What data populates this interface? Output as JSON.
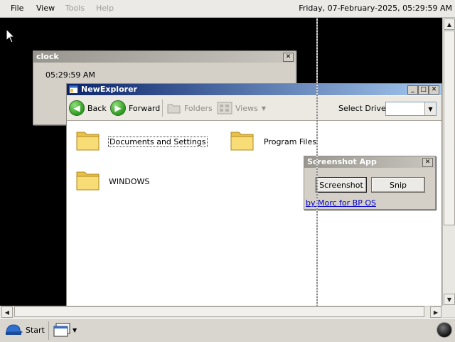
{
  "menubar": {
    "file": "File",
    "view": "View",
    "tools": "Tools",
    "help": "Help",
    "datetime": "Friday, 07-February-2025, 05:29:59 AM"
  },
  "clock_window": {
    "title": "clock",
    "time": "05:29:59 AM"
  },
  "explorer": {
    "title": "NewExplorer",
    "back": "Back",
    "forward": "Forward",
    "folders": "Folders",
    "views": "Views",
    "select_drive_label": "Select Drive:",
    "select_drive_value": "",
    "items": [
      {
        "name": "Documents and Settings"
      },
      {
        "name": "Program Files"
      },
      {
        "name": "WINDOWS"
      }
    ]
  },
  "screenshot_app": {
    "title": "Screenshot App",
    "screenshot_button": "Screenshot",
    "snip_button": "Snip",
    "credit_link": "by Morc for BP OS"
  },
  "taskbar": {
    "start": "Start"
  },
  "colors": {
    "desktop": "#000000",
    "active_title": "#0a246a",
    "link": "#0000cc"
  }
}
